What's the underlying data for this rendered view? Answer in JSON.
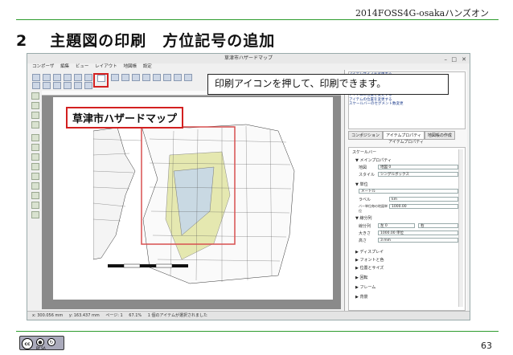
{
  "header": {
    "text": "2014FOSS4G-osakaハンズオン"
  },
  "slide": {
    "number": "2",
    "title": "主題図の印刷　方位記号の追加"
  },
  "window": {
    "title": "草津市ハザードマップ",
    "menu": [
      "コンポーザ",
      "編集",
      "ビュー",
      "レイアウト",
      "地図帳",
      "設定"
    ]
  },
  "map": {
    "title": "草津市ハザードマップ"
  },
  "panel": {
    "history": [
      "アイテムサイズを変更する",
      "アイテムサイズを変更する",
      "アイテムサイズを変更する",
      "アイテムサイズを変更する",
      "アイテムサイズを変更する",
      "アイテムの位置を変更する",
      "アイテムの位置を変更する",
      "スケールバーのセグメント数変更"
    ],
    "tabs": [
      "コンポジション",
      "アイテムプロパティ",
      "地図帳の作成"
    ],
    "subtitle": "アイテムプロパティ",
    "section_scalebar": "スケールバー",
    "section_main": "メインプロパティ",
    "map_label": "地図",
    "map_value": "地図 0",
    "style_label": "スタイル",
    "style_value": "シングルボックス",
    "section_units": "単位",
    "units_value": "メートル",
    "label_label": "ラベル",
    "label_value": "km",
    "mapunits_label": "バー単位毎の地図単位",
    "mapunits_value": "1000.00",
    "section_segments": "線分列",
    "segments_label": "線分列",
    "segments_left": "左 0",
    "segments_right": "右",
    "size_label": "大きさ",
    "size_value": "1000.00 単位",
    "height_label": "高さ",
    "height_value": "3 mm",
    "collapsed": [
      "ディスプレイ",
      "フォントと色",
      "位置とサイズ",
      "回転",
      "フレーム",
      "背景"
    ]
  },
  "status": {
    "x": "x: 300.056 mm",
    "y": "y: 163.437 mm",
    "page": "ページ: 1",
    "zoom": "67.1%",
    "message": "1 個のアイテムが選択されました"
  },
  "callout": {
    "text": "印刷アイコンを押して、印刷できます。"
  },
  "footer": {
    "page": "63"
  },
  "colors": {
    "accent": "#2e9c2e",
    "highlight": "#d32020"
  }
}
